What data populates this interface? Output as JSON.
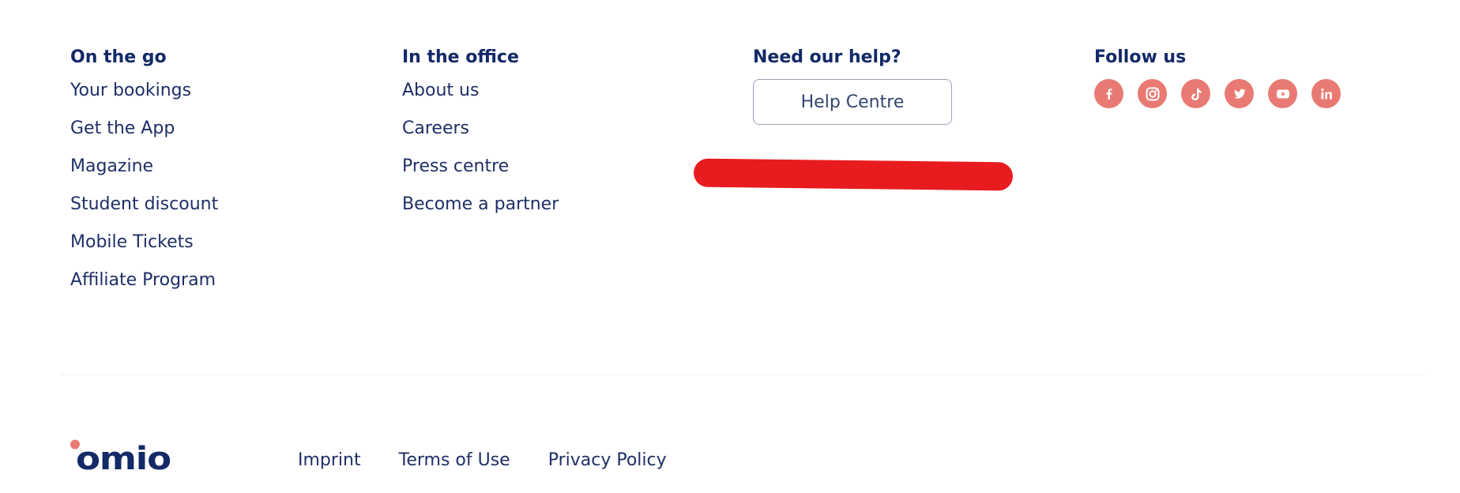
{
  "columns": {
    "on_the_go": {
      "title": "On the go",
      "links": [
        "Your bookings",
        "Get the App",
        "Magazine",
        "Student discount",
        "Mobile Tickets",
        "Affiliate Program"
      ]
    },
    "in_the_office": {
      "title": "In the office",
      "links": [
        "About us",
        "Careers",
        "Press centre",
        "Become a partner"
      ]
    },
    "help": {
      "title": "Need our help?",
      "button_label": "Help Centre"
    },
    "follow": {
      "title": "Follow us",
      "icons": [
        "facebook-icon",
        "instagram-icon",
        "tiktok-icon",
        "twitter-icon",
        "youtube-icon",
        "linkedin-icon"
      ]
    }
  },
  "bottom": {
    "logo_text": "omio",
    "links": [
      "Imprint",
      "Terms of Use",
      "Privacy Policy"
    ]
  },
  "colors": {
    "text_primary": "#132968",
    "social_icon_bg": "#e97a73",
    "logo_dot": "#e97a73",
    "redaction": "#e81c1f"
  }
}
